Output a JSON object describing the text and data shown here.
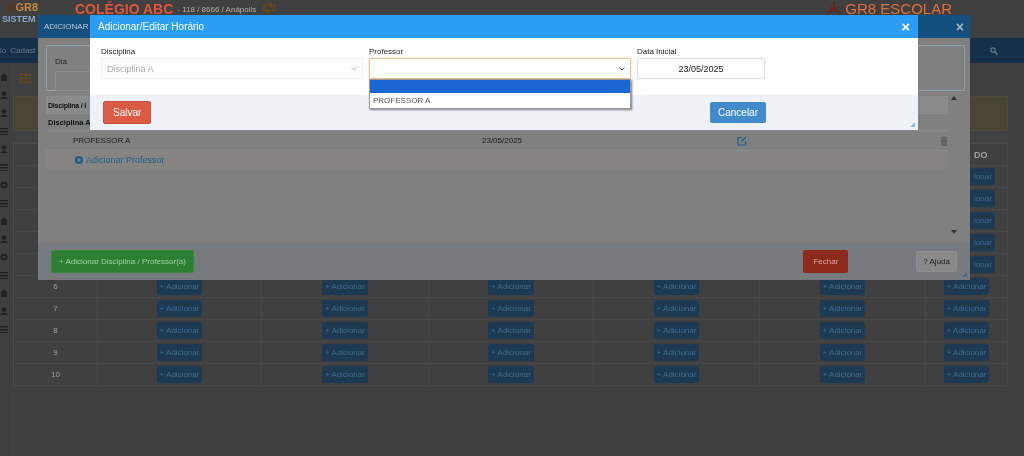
{
  "page": {
    "logo": "GR8",
    "logo_sub": "SISTEM",
    "school": "COLÉGIO ABC",
    "school_info": "- 118 / 8666 / Anápolis",
    "brand": "GR8 ESCOLAR",
    "nav_items": [
      "io",
      "Cadast"
    ],
    "schedule_grid": {
      "last_column_heading": "DO",
      "upper_rows": [
        {
          "last_button": "ionar"
        },
        {
          "last_button": "ionar"
        },
        {
          "last_button": "ionar"
        },
        {
          "last_button": "ionar"
        },
        {
          "last_button": "ionar"
        }
      ],
      "rows": [
        {
          "number": "6",
          "buttons": [
            "+ Adicionar",
            "+ Adicionar",
            "+ Adicionar",
            "+ Adicionar",
            "+ Adicionar",
            "+ Adicionar"
          ]
        },
        {
          "number": "7",
          "buttons": [
            "+ Adicionar",
            "+ Adicionar",
            "+ Adicionar",
            "+ Adicionar",
            "+ Adicionar",
            "+ Adicionar"
          ]
        },
        {
          "number": "8",
          "buttons": [
            "+ Adicionar",
            "+ Adicionar",
            "+ Adicionar",
            "+ Adicionar",
            "+ Adicionar",
            "+ Adicionar"
          ]
        },
        {
          "number": "9",
          "buttons": [
            "+ Adicionar",
            "+ Adicionar",
            "+ Adicionar",
            "+ Adicionar",
            "+ Adicionar",
            "+ Adicionar"
          ]
        },
        {
          "number": "10",
          "buttons": [
            "+ Adicionar",
            "+ Adicionar",
            "+ Adicionar",
            "+ Adicionar",
            "+ Adicionar",
            "+ Adicionar"
          ]
        }
      ]
    }
  },
  "outer_dialog": {
    "title": "ADICIONAR",
    "close_icon": "×",
    "day_label": "Dia",
    "table_heading": "Disciplina / I",
    "groups": [
      {
        "name": "Disciplina A",
        "teachers": [
          {
            "name": "PROFESSOR A",
            "date": "23/05/2025"
          }
        ],
        "add_link": "Adicionar Professor"
      }
    ],
    "add_button": "+ Adicionar Disciplina / Professor(a)",
    "close_button": "Fechar",
    "help_button": "? Ajuda"
  },
  "dialog": {
    "title": "Adicionar/Editar Horário",
    "close_icon": "×",
    "fields": [
      {
        "kind": "select",
        "label": "Disciplina",
        "value": "Disciplina A",
        "disabled": true,
        "focused": false
      },
      {
        "kind": "select",
        "label": "Professor",
        "disabled": false,
        "focused": true
      },
      {
        "kind": "date",
        "label": "Data Inicial",
        "value": "23/05/2025",
        "disabled": false,
        "focused": false
      }
    ],
    "open_dropdown": {
      "options": [
        {
          "selected": true
        },
        {
          "label": "PROFESSOR A",
          "selected": false
        }
      ]
    },
    "buttons": {
      "save": "Salvar",
      "cancel": "Cancelar"
    }
  }
}
